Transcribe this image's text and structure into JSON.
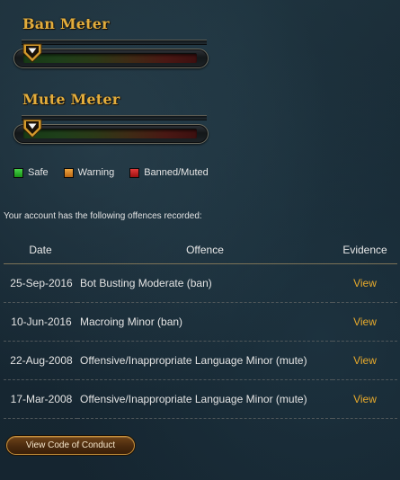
{
  "meters": {
    "ban": {
      "title": "Ban Meter",
      "level": 0
    },
    "mute": {
      "title": "Mute Meter",
      "level": 0
    }
  },
  "legend": [
    {
      "label": "Safe",
      "color": "#2fb62f"
    },
    {
      "label": "Warning",
      "color": "#d9862a"
    },
    {
      "label": "Banned/Muted",
      "color": "#c42222"
    }
  ],
  "intro": "Your account has the following offences recorded:",
  "table": {
    "headers": {
      "date": "Date",
      "offence": "Offence",
      "evidence": "Evidence"
    },
    "rows": [
      {
        "date": "25-Sep-2016",
        "offence": "Bot Busting Moderate (ban)",
        "evidence": "View"
      },
      {
        "date": "10-Jun-2016",
        "offence": "Macroing Minor (ban)",
        "evidence": "View"
      },
      {
        "date": "22-Aug-2008",
        "offence": "Offensive/Inappropriate Language Minor (mute)",
        "evidence": "View"
      },
      {
        "date": "17-Mar-2008",
        "offence": "Offensive/Inappropriate Language Minor (mute)",
        "evidence": "View"
      }
    ]
  },
  "button": {
    "label": "View Code of Conduct"
  },
  "colors": {
    "title": "#e3ad3c",
    "link": "#e8aa2c",
    "background": "#172833"
  }
}
